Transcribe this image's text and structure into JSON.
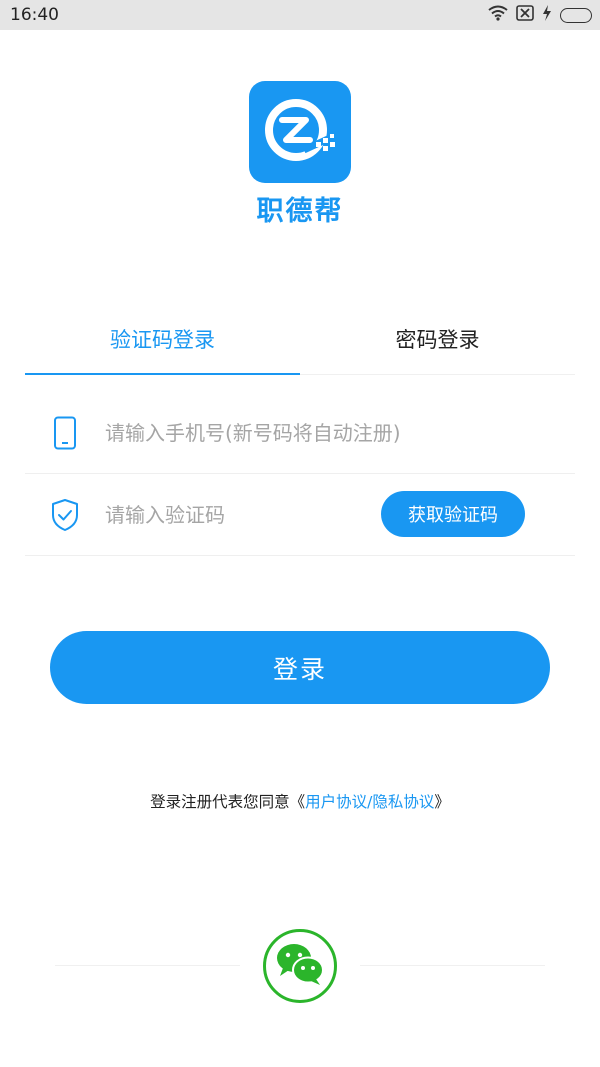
{
  "status_bar": {
    "time": "16:40"
  },
  "brand": {
    "name": "职德帮",
    "color": "#1997f2"
  },
  "tabs": [
    {
      "label": "验证码登录",
      "active": true
    },
    {
      "label": "密码登录",
      "active": false
    }
  ],
  "form": {
    "phone": {
      "placeholder": "请输入手机号(新号码将自动注册)",
      "value": ""
    },
    "code": {
      "placeholder": "请输入验证码",
      "value": ""
    },
    "get_code_label": "获取验证码",
    "login_label": "登录"
  },
  "agreement": {
    "prefix": "登录注册代表您同意《",
    "link_text": "用户协议/隐私协议",
    "suffix": "》"
  },
  "colors": {
    "accent": "#1997f2",
    "wechat": "#2bb52b"
  },
  "third_party": {
    "provider": "wechat"
  }
}
